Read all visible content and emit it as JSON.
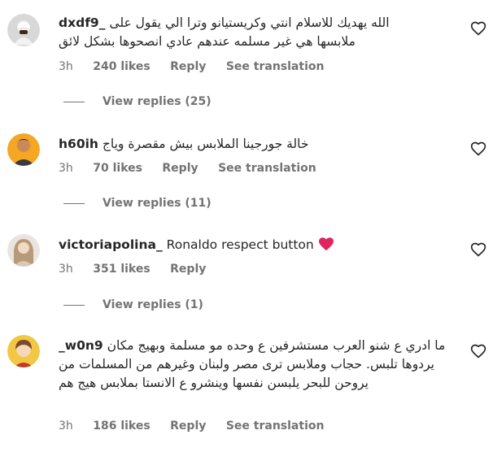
{
  "comments": [
    {
      "username": "dxdf9_",
      "text": "الله يهديك للاسلام انتي وكريستيانو وترا الي يقول على ملابسها هي غير مسلمه عندهم عادي انصحوها بشكل لائق",
      "time": "3h",
      "likes": "240 likes",
      "reply_label": "Reply",
      "translate_label": "See translation",
      "view_replies": "View replies (25)",
      "avatar_icon": "person-avatar-icon"
    },
    {
      "username": "h60ih",
      "text": "خالة جورجينا الملابس بيش مقصرة وياج",
      "time": "3h",
      "likes": "70 likes",
      "reply_label": "Reply",
      "translate_label": "See translation",
      "view_replies": "View replies (11)",
      "avatar_icon": "person-avatar-icon"
    },
    {
      "username": "victoriapolina_",
      "text": "Ronaldo respect button",
      "emoji": "red-heart",
      "time": "3h",
      "likes": "351 likes",
      "reply_label": "Reply",
      "view_replies": "View replies (1)",
      "avatar_icon": "person-avatar-icon"
    },
    {
      "username": "_w0n9",
      "text": "ما ادري ع شنو العرب مستشرفين ع وحده مو مسلمة وبهيج مكان يردوها تلبس. حجاب وملابس ترى مصر ولبنان وغيرهم من المسلمات من يروحن للبحر يلبسن نفسها وينشرو ع الانستا بملابس هيج هم",
      "time": "3h",
      "likes": "186 likes",
      "reply_label": "Reply",
      "translate_label": "See translation",
      "avatar_icon": "person-avatar-icon"
    }
  ],
  "colors": {
    "text": "#262626",
    "secondary": "#737373",
    "emoji_heart": "#e0245e"
  }
}
